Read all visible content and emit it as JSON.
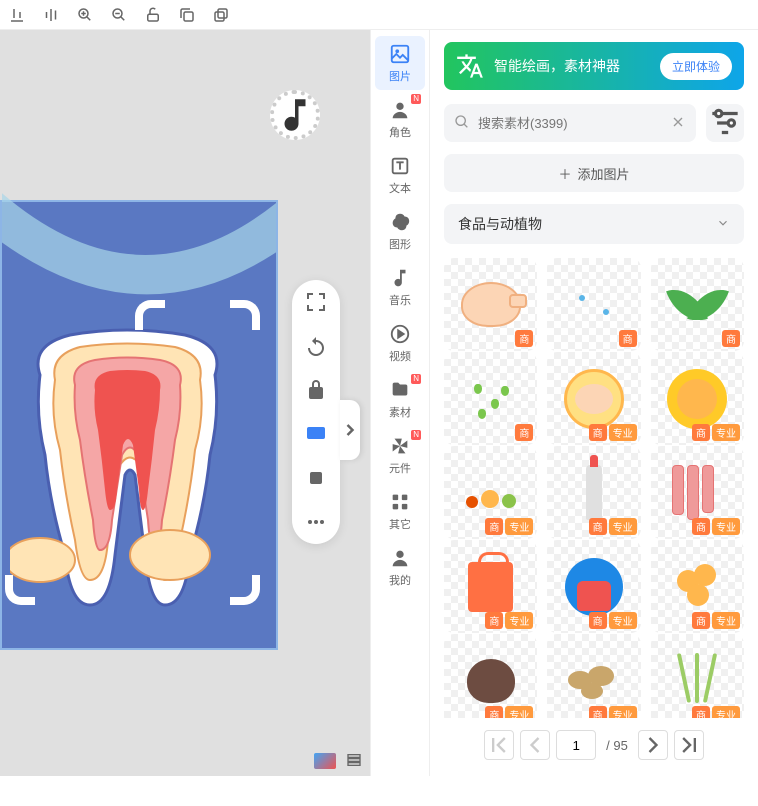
{
  "toolbar": {
    "icons": [
      "align-bottom",
      "align-center-v",
      "zoom-in",
      "zoom-out",
      "unlock",
      "copy",
      "paste"
    ]
  },
  "side_nav": [
    {
      "id": "image",
      "label": "图片",
      "icon": "image-icon",
      "active": true
    },
    {
      "id": "role",
      "label": "角色",
      "icon": "person-icon",
      "badge": "N"
    },
    {
      "id": "text",
      "label": "文本",
      "icon": "text-icon"
    },
    {
      "id": "shape",
      "label": "图形",
      "icon": "shape-icon"
    },
    {
      "id": "music",
      "label": "音乐",
      "icon": "music-icon"
    },
    {
      "id": "video",
      "label": "视频",
      "icon": "play-icon"
    },
    {
      "id": "asset",
      "label": "素材",
      "icon": "folder-icon",
      "badge": "N"
    },
    {
      "id": "component",
      "label": "元件",
      "icon": "pinwheel-icon",
      "badge": "N"
    },
    {
      "id": "other",
      "label": "其它",
      "icon": "grid-icon"
    },
    {
      "id": "mine",
      "label": "我的",
      "icon": "user-icon"
    }
  ],
  "banner": {
    "text": "智能绘画，素材神器",
    "button": "立即体验"
  },
  "search": {
    "placeholder": "搜索素材(3399)"
  },
  "add_button": "添加图片",
  "category": "食品与动植物",
  "assets": [
    {
      "shape": "chicken",
      "badges": [
        "商"
      ]
    },
    {
      "shape": "dots",
      "badges": [
        "商"
      ]
    },
    {
      "shape": "leaf",
      "badges": [
        "商"
      ]
    },
    {
      "shape": "gdots",
      "badges": [
        "商"
      ]
    },
    {
      "shape": "plate",
      "badges": [
        "商",
        "专业"
      ]
    },
    {
      "shape": "egg",
      "badges": [
        "商",
        "专业"
      ]
    },
    {
      "shape": "food",
      "badges": [
        "商",
        "专业"
      ]
    },
    {
      "shape": "bottle",
      "badges": [
        "商",
        "专业"
      ]
    },
    {
      "shape": "meat",
      "badges": [
        "商",
        "专业"
      ]
    },
    {
      "shape": "bag",
      "badges": [
        "商",
        "专业"
      ]
    },
    {
      "shape": "circle-food",
      "badges": [
        "商",
        "专业"
      ]
    },
    {
      "shape": "nuts",
      "badges": [
        "商",
        "专业"
      ]
    },
    {
      "shape": "chestnut",
      "badges": [
        "商",
        "专业"
      ]
    },
    {
      "shape": "potato",
      "badges": [
        "商",
        "专业"
      ]
    },
    {
      "shape": "wheat",
      "badges": [
        "商",
        "专业"
      ]
    }
  ],
  "pagination": {
    "current": "1",
    "total": "/ 95"
  }
}
